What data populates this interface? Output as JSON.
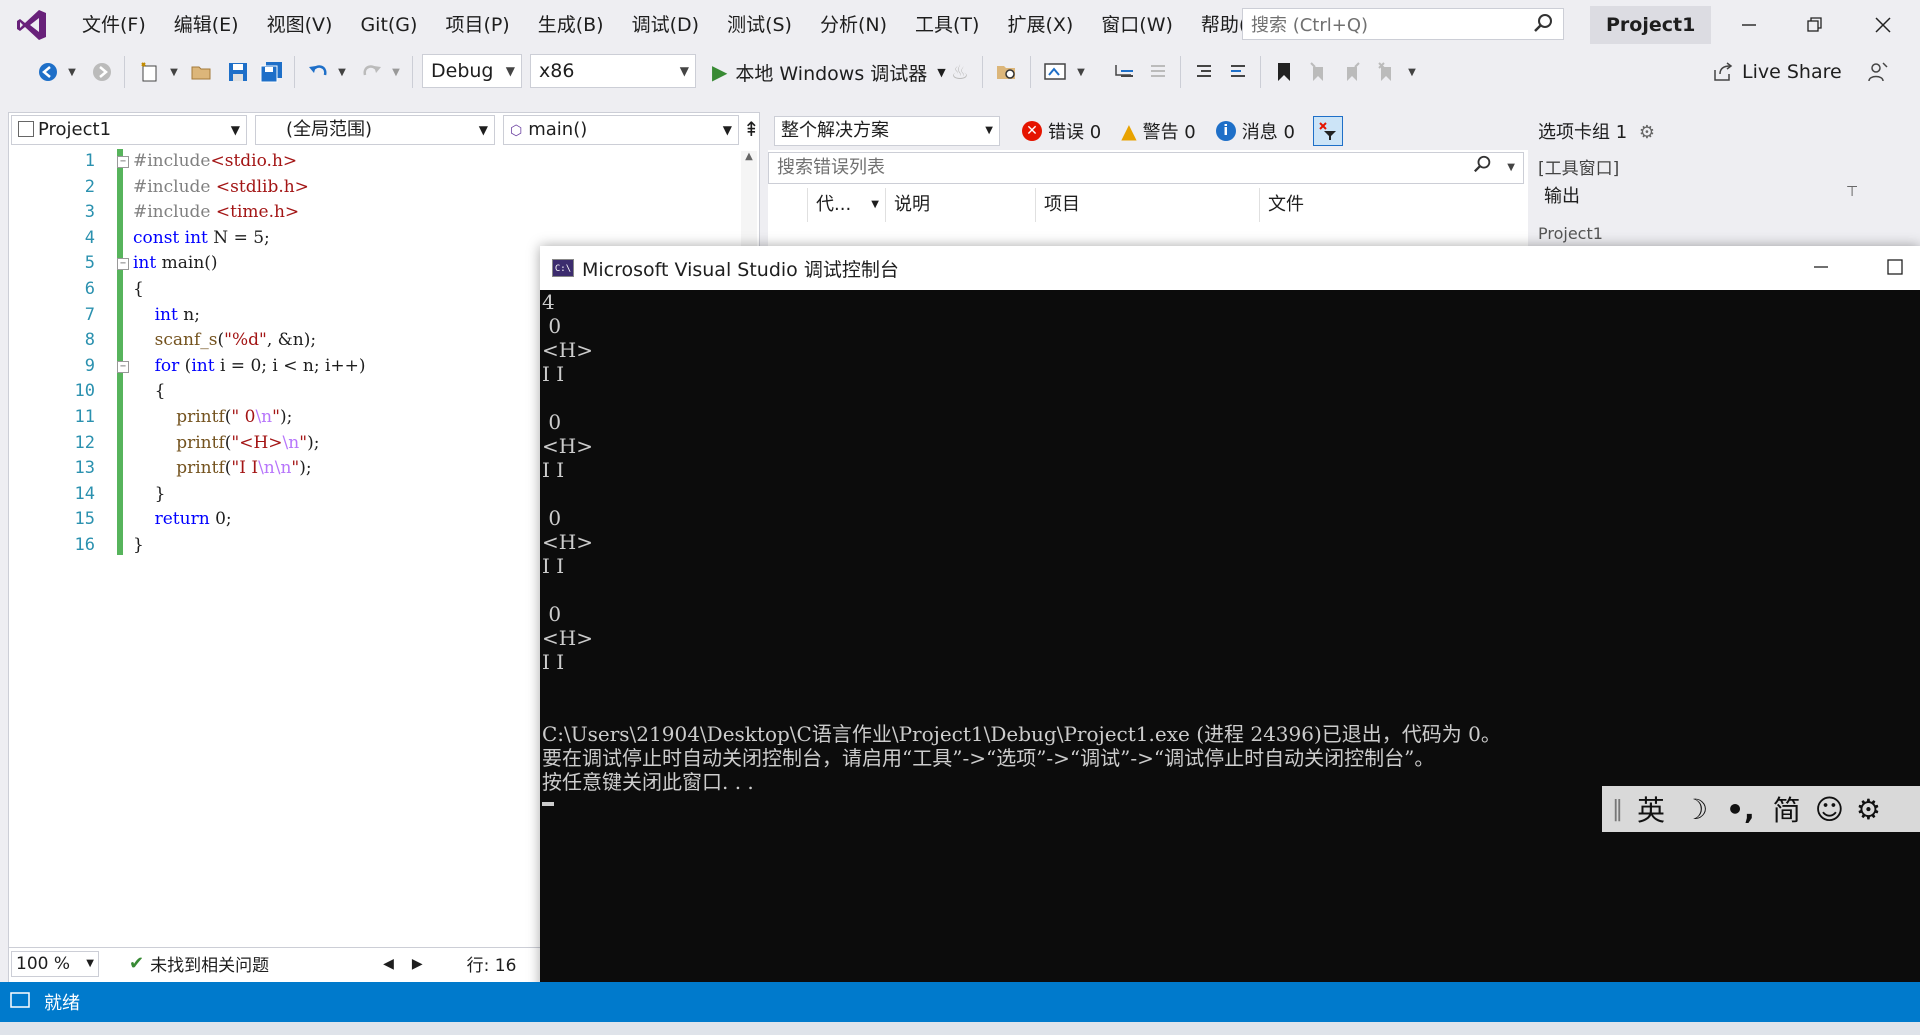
{
  "app": {
    "menu": [
      "文件(F)",
      "编辑(E)",
      "视图(V)",
      "Git(G)",
      "项目(P)",
      "生成(B)",
      "调试(D)",
      "测试(S)",
      "分析(N)",
      "工具(T)",
      "扩展(X)",
      "窗口(W)",
      "帮助(H)"
    ],
    "search_placeholder": "搜索 (Ctrl+Q)",
    "project_title": "Project1",
    "accent": "#68217a"
  },
  "toolbar": {
    "config": "Debug",
    "platform": "x86",
    "run_label": "本地 Windows 调试器",
    "live_share": "Live Share"
  },
  "editor": {
    "project_combo": "Project1",
    "scope_combo": "(全局范围)",
    "member_combo": "main()",
    "line_numbers": [
      "1",
      "2",
      "3",
      "4",
      "5",
      "6",
      "7",
      "8",
      "9",
      "10",
      "11",
      "12",
      "13",
      "14",
      "15",
      "16"
    ],
    "zoom": "100 %",
    "issues": "未找到相关问题",
    "line_pos": "行: 16"
  },
  "error_list": {
    "scope": "整个解决方案",
    "errors": "错误 0",
    "warnings": "警告 0",
    "messages": "消息 0",
    "search_placeholder": "搜索错误列表",
    "col_code": "代...",
    "col_desc": "说明",
    "col_project": "项目",
    "col_file": "文件"
  },
  "tool_window": {
    "tab_group": "选项卡组 1",
    "section": "[工具窗口]",
    "output": "输出",
    "project": "Project1"
  },
  "console": {
    "title": "Microsoft Visual Studio 调试控制台",
    "icon_text": "C:\\",
    "lines": [
      "4",
      " 0",
      "<H>",
      "I I",
      "",
      " 0",
      "<H>",
      "I I",
      "",
      " 0",
      "<H>",
      "I I",
      "",
      " 0",
      "<H>",
      "I I",
      "",
      "",
      "C:\\Users\\21904\\Desktop\\C语言作业\\Project1\\Debug\\Project1.exe (进程 24396)已退出，代码为 0。",
      "要在调试停止时自动关闭控制台，请启用“工具”->“选项”->“调试”->“调试停止时自动关闭控制台”。",
      "按任意键关闭此窗口. . ."
    ]
  },
  "ime": {
    "lang": "英",
    "mode": "简"
  },
  "status": {
    "ready": "就绪"
  }
}
